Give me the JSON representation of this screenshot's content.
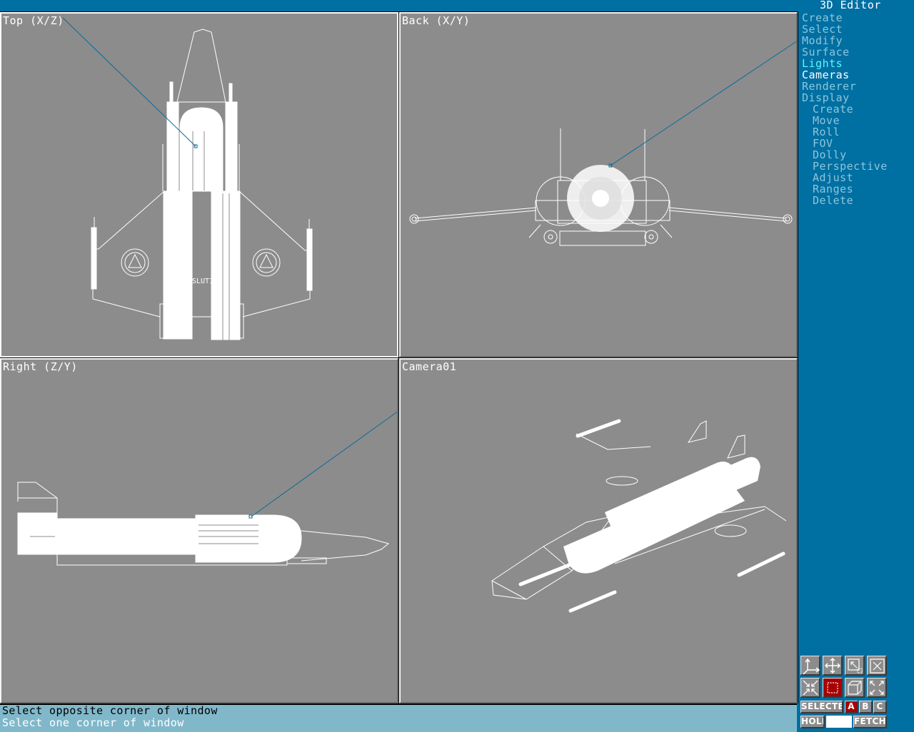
{
  "app": {
    "title": "3D Editor"
  },
  "viewports": [
    {
      "id": "top",
      "label": "Top (X/Z)"
    },
    {
      "id": "back",
      "label": "Back (X/Y)"
    },
    {
      "id": "right",
      "label": "Right (Z/Y)"
    },
    {
      "id": "camera",
      "label": "Camera01"
    }
  ],
  "menu": {
    "items": [
      {
        "label": "Create",
        "state": "normal",
        "level": 0
      },
      {
        "label": "Select",
        "state": "normal",
        "level": 0
      },
      {
        "label": "Modify",
        "state": "normal",
        "level": 0
      },
      {
        "label": "Surface",
        "state": "normal",
        "level": 0
      },
      {
        "label": "Lights",
        "state": "highlight",
        "level": 0
      },
      {
        "label": "Cameras",
        "state": "active",
        "level": 0
      },
      {
        "label": "Renderer",
        "state": "normal",
        "level": 0
      },
      {
        "label": "Display",
        "state": "normal",
        "level": 0
      },
      {
        "label": "Create",
        "state": "normal",
        "level": 1
      },
      {
        "label": "Move",
        "state": "normal",
        "level": 1
      },
      {
        "label": "Roll",
        "state": "normal",
        "level": 1
      },
      {
        "label": "FOV",
        "state": "normal",
        "level": 1
      },
      {
        "label": "Dolly",
        "state": "normal",
        "level": 1
      },
      {
        "label": "Perspective",
        "state": "normal",
        "level": 1
      },
      {
        "label": "Adjust",
        "state": "normal",
        "level": 1
      },
      {
        "label": "Ranges",
        "state": "normal",
        "level": 1
      },
      {
        "label": "Delete",
        "state": "normal",
        "level": 1
      }
    ]
  },
  "toolbar": {
    "icons": [
      {
        "name": "axis-constraint-icon"
      },
      {
        "name": "pan-icon"
      },
      {
        "name": "zoom-window-icon"
      },
      {
        "name": "full-screen-toggle-icon"
      },
      {
        "name": "zoom-out-icon"
      },
      {
        "name": "region-select-icon",
        "active": true
      },
      {
        "name": "box-view-icon"
      },
      {
        "name": "zoom-extents-icon"
      }
    ],
    "selected_label": "SELECTED",
    "selection_sets": [
      "A",
      "B",
      "C"
    ],
    "active_set": "A",
    "hold_label": "HOLD",
    "fetch_label": "FETCH"
  },
  "status": {
    "line1": "Select opposite corner of window",
    "line2": "Select one corner of window"
  },
  "colors": {
    "background": "#006fa2",
    "viewport": "#8c8c8c",
    "menu_normal": "#8dc6dc",
    "menu_highlight": "#5ff6ff",
    "menu_active": "#ffffff",
    "status_bg": "#80b8ca",
    "active_red": "#a80000",
    "camera_line": "#0a6b96"
  }
}
